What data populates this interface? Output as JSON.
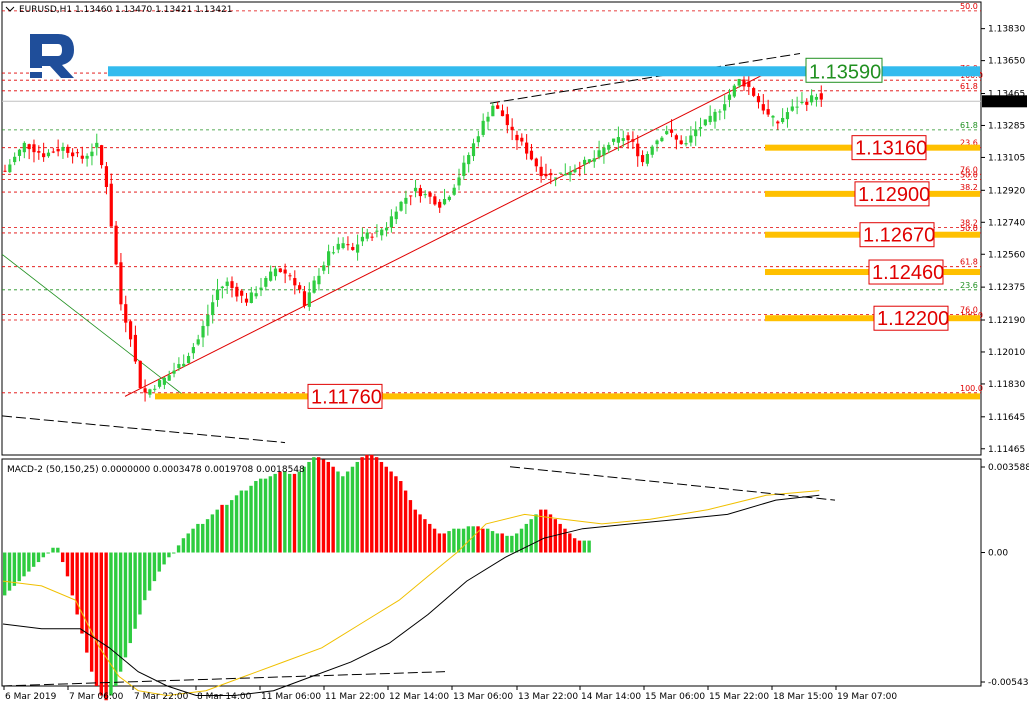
{
  "header": {
    "main_title": "EURUSD,H1  1.13460 1.13470 1.13421 1.13421",
    "macd_title": "MACD-2 (50,150,25) 0.0000000 0.0003478 0.0019708 0.0018548"
  },
  "colors": {
    "bull": "#2ecc40",
    "bear": "#ff0000",
    "fib_red": "#e00000",
    "fib_green": "#209020",
    "level_orange": "#ffc000",
    "level_blue": "#33bbee",
    "signal_line": "#f0c000",
    "macd_line": "#000000",
    "logo": "#1f4e9a"
  },
  "chart_data": [
    {
      "type": "candlestick",
      "title": "EURUSD,H1  1.13460 1.13470 1.13421 1.13421",
      "y_ticks": [
        "1.13830",
        "1.13650",
        "1.13465",
        "1.13285",
        "1.13105",
        "1.12920",
        "1.12740",
        "1.12560",
        "1.12375",
        "1.12190",
        "1.12010",
        "1.11830",
        "1.11645",
        "1.11465"
      ],
      "current_price": "1.13421",
      "x_ticks": [
        "6 Mar 2019",
        "7 Mar 06:00",
        "7 Mar 22:00",
        "8 Mar 14:00",
        "11 Mar 06:00",
        "11 Mar 22:00",
        "12 Mar 14:00",
        "13 Mar 06:00",
        "13 Mar 22:00",
        "14 Mar 14:00",
        "15 Mar 06:00",
        "15 Mar 22:00",
        "18 Mar 15:00",
        "19 Mar 07:00"
      ],
      "price_path": [
        [
          0,
          1.1303
        ],
        [
          4,
          1.1318
        ],
        [
          8,
          1.1312
        ],
        [
          12,
          1.1316
        ],
        [
          16,
          1.131
        ],
        [
          19,
          1.1317
        ],
        [
          21,
          1.1295
        ],
        [
          23,
          1.125
        ],
        [
          24,
          1.1228
        ],
        [
          26,
          1.121
        ],
        [
          27,
          1.1195
        ],
        [
          28,
          1.1182
        ],
        [
          29,
          1.1178
        ],
        [
          31,
          1.1182
        ],
        [
          34,
          1.1188
        ],
        [
          37,
          1.1196
        ],
        [
          40,
          1.1208
        ],
        [
          42,
          1.1222
        ],
        [
          44,
          1.1236
        ],
        [
          46,
          1.124
        ],
        [
          48,
          1.1234
        ],
        [
          50,
          1.123
        ],
        [
          53,
          1.1238
        ],
        [
          56,
          1.1248
        ],
        [
          59,
          1.1244
        ],
        [
          61,
          1.1236
        ],
        [
          62,
          1.1226
        ],
        [
          64,
          1.124
        ],
        [
          67,
          1.1256
        ],
        [
          70,
          1.1262
        ],
        [
          72,
          1.1258
        ],
        [
          74,
          1.1266
        ],
        [
          77,
          1.1268
        ],
        [
          79,
          1.1272
        ],
        [
          81,
          1.1282
        ],
        [
          83,
          1.1288
        ],
        [
          85,
          1.1292
        ],
        [
          88,
          1.1288
        ],
        [
          90,
          1.1284
        ],
        [
          92,
          1.129
        ],
        [
          94,
          1.13
        ],
        [
          96,
          1.1312
        ],
        [
          99,
          1.133
        ],
        [
          101,
          1.134
        ],
        [
          103,
          1.1334
        ],
        [
          105,
          1.1324
        ],
        [
          107,
          1.1318
        ],
        [
          109,
          1.131
        ],
        [
          111,
          1.1302
        ],
        [
          113,
          1.13
        ],
        [
          116,
          1.1302
        ],
        [
          119,
          1.1306
        ],
        [
          122,
          1.131
        ],
        [
          125,
          1.1318
        ],
        [
          128,
          1.1322
        ],
        [
          130,
          1.1318
        ],
        [
          132,
          1.1308
        ],
        [
          134,
          1.1318
        ],
        [
          137,
          1.1326
        ],
        [
          139,
          1.132
        ],
        [
          141,
          1.1318
        ],
        [
          143,
          1.1326
        ],
        [
          146,
          1.1332
        ],
        [
          148,
          1.1338
        ],
        [
          150,
          1.1346
        ],
        [
          152,
          1.1354
        ],
        [
          154,
          1.135
        ],
        [
          156,
          1.1342
        ],
        [
          158,
          1.1334
        ],
        [
          160,
          1.133
        ],
        [
          162,
          1.1336
        ],
        [
          164,
          1.134
        ],
        [
          166,
          1.1342
        ],
        [
          168,
          1.1346
        ],
        [
          169,
          1.1342
        ]
      ],
      "fib_levels": [
        {
          "price": 1.1359,
          "label": "1.13590",
          "pct": "76.0",
          "color": "green"
        },
        {
          "price": 1.1316,
          "label": "1.13160",
          "pct": "23.6",
          "color": "red"
        },
        {
          "price": 1.129,
          "label": "1.12900",
          "pct": "38.2",
          "color": "red"
        },
        {
          "price": 1.1267,
          "label": "1.12670",
          "pct": "38.2",
          "color": "red"
        },
        {
          "price": 1.1246,
          "label": "1.12460",
          "pct": "61.8",
          "color": "red"
        },
        {
          "price": 1.122,
          "label": "1.12200",
          "pct": "76.0",
          "color": "red"
        },
        {
          "price": 1.1176,
          "label": "1.11760",
          "pct": "100.0",
          "color": "red"
        }
      ],
      "fib_small_labels": [
        {
          "price": 1.1393,
          "text": "50.0",
          "color": "red"
        },
        {
          "price": 1.1358,
          "text": "76.0",
          "color": "red"
        },
        {
          "price": 1.1354,
          "text": "100.0",
          "color": "red"
        },
        {
          "price": 1.1348,
          "text": "61.8",
          "color": "red"
        },
        {
          "price": 1.1326,
          "text": "61.8",
          "color": "green"
        },
        {
          "price": 1.1316,
          "text": "23.6",
          "color": "red"
        },
        {
          "price": 1.1301,
          "text": "76.0",
          "color": "red"
        },
        {
          "price": 1.1298,
          "text": "50.0",
          "color": "red"
        },
        {
          "price": 1.1291,
          "text": "38.2",
          "color": "red"
        },
        {
          "price": 1.1271,
          "text": "38.2",
          "color": "red"
        },
        {
          "price": 1.1268,
          "text": "50.0",
          "color": "red"
        },
        {
          "price": 1.1249,
          "text": "61.8",
          "color": "red"
        },
        {
          "price": 1.1236,
          "text": "23.6",
          "color": "green"
        },
        {
          "price": 1.1222,
          "text": "76.0",
          "color": "red"
        },
        {
          "price": 1.1219,
          "text": "100.0",
          "color": "red"
        },
        {
          "price": 1.1178,
          "text": "100.0",
          "color": "red"
        }
      ]
    },
    {
      "type": "bar",
      "title": "MACD-2 (50,150,25) 0.0000000 0.0003478 0.0019708 0.0018548",
      "y_ticks": [
        "0.0035887",
        "0.00",
        "-0.0054336"
      ],
      "histogram": [
        -0.0018,
        -0.0016,
        -0.0014,
        -0.0012,
        -0.001,
        -0.0008,
        -0.0006,
        -0.0004,
        -0.0002,
        0.0,
        0.0002,
        0.0002,
        -0.0004,
        -0.001,
        -0.0018,
        -0.0026,
        -0.0034,
        -0.0042,
        -0.005,
        -0.0056,
        -0.006,
        -0.0062,
        -0.006,
        -0.0056,
        -0.005,
        -0.0044,
        -0.0038,
        -0.0032,
        -0.0026,
        -0.002,
        -0.0016,
        -0.0012,
        -0.0008,
        -0.0005,
        -0.0002,
        0.0,
        0.0003,
        0.0006,
        0.0008,
        0.001,
        0.0012,
        0.0012,
        0.0014,
        0.0016,
        0.0018,
        0.002,
        0.002,
        0.0022,
        0.0024,
        0.0026,
        0.0026,
        0.0028,
        0.003,
        0.0031,
        0.0031,
        0.0032,
        0.0033,
        0.0034,
        0.0034,
        0.0033,
        0.0033,
        0.0034,
        0.0036,
        0.0038,
        0.004,
        0.004,
        0.0039,
        0.0038,
        0.0036,
        0.0034,
        0.0032,
        0.0034,
        0.0036,
        0.0038,
        0.004,
        0.0041,
        0.0041,
        0.004,
        0.0038,
        0.0036,
        0.0034,
        0.0032,
        0.003,
        0.0026,
        0.0022,
        0.0018,
        0.0016,
        0.0014,
        0.0012,
        0.001,
        0.0008,
        0.0008,
        0.0009,
        0.001,
        0.001,
        0.001,
        0.0011,
        0.0011,
        0.0011,
        0.001,
        0.001,
        0.0009,
        0.0008,
        0.0008,
        0.0007,
        0.0007,
        0.0008,
        0.001,
        0.0012,
        0.0014,
        0.0016,
        0.0018,
        0.0018,
        0.0016,
        0.0014,
        0.0012,
        0.001,
        0.0008,
        0.0006,
        0.0005,
        0.0005,
        0.0005
      ],
      "bar_colors": [
        "g",
        "g",
        "g",
        "g",
        "g",
        "g",
        "g",
        "g",
        "g",
        "g",
        "g",
        "g",
        "r",
        "r",
        "r",
        "r",
        "r",
        "r",
        "r",
        "r",
        "r",
        "r",
        "g",
        "g",
        "g",
        "g",
        "g",
        "g",
        "g",
        "g",
        "g",
        "g",
        "g",
        "g",
        "g",
        "g",
        "g",
        "g",
        "g",
        "g",
        "g",
        "g",
        "g",
        "g",
        "g",
        "r",
        "g",
        "g",
        "g",
        "g",
        "g",
        "g",
        "g",
        "g",
        "g",
        "g",
        "g",
        "r",
        "g",
        "g",
        "r",
        "g",
        "g",
        "g",
        "g",
        "r",
        "r",
        "r",
        "r",
        "g",
        "g",
        "g",
        "g",
        "g",
        "r",
        "r",
        "r",
        "r",
        "r",
        "r",
        "r",
        "r",
        "r",
        "r",
        "r",
        "r",
        "r",
        "r",
        "r",
        "r",
        "r",
        "r",
        "g",
        "g",
        "g",
        "g",
        "g",
        "g",
        "r",
        "r",
        "g",
        "g",
        "g",
        "r",
        "g",
        "g",
        "g",
        "g",
        "g",
        "g",
        "g",
        "r",
        "r",
        "r",
        "r",
        "r",
        "r",
        "r",
        "r",
        "r",
        "g",
        "g"
      ],
      "signal_path": [
        [
          0,
          -0.0012
        ],
        [
          8,
          -0.0014
        ],
        [
          15,
          -0.002
        ],
        [
          20,
          -0.004
        ],
        [
          24,
          -0.0052
        ],
        [
          28,
          -0.0058
        ],
        [
          34,
          -0.006
        ],
        [
          42,
          -0.0058
        ],
        [
          50,
          -0.0052
        ],
        [
          58,
          -0.0046
        ],
        [
          66,
          -0.004
        ],
        [
          74,
          -0.003
        ],
        [
          82,
          -0.002
        ],
        [
          88,
          -0.001
        ],
        [
          94,
          0.0
        ],
        [
          100,
          0.0012
        ],
        [
          108,
          0.0016
        ],
        [
          116,
          0.0014
        ],
        [
          124,
          0.0012
        ],
        [
          134,
          0.0014
        ],
        [
          146,
          0.0018
        ],
        [
          158,
          0.0024
        ],
        [
          169,
          0.0026
        ]
      ],
      "macd_path": [
        [
          0,
          -0.003
        ],
        [
          8,
          -0.0032
        ],
        [
          16,
          -0.0032
        ],
        [
          22,
          -0.004
        ],
        [
          28,
          -0.005
        ],
        [
          34,
          -0.0056
        ],
        [
          40,
          -0.006
        ],
        [
          48,
          -0.006
        ],
        [
          56,
          -0.0058
        ],
        [
          64,
          -0.0052
        ],
        [
          72,
          -0.0046
        ],
        [
          80,
          -0.0038
        ],
        [
          88,
          -0.0026
        ],
        [
          96,
          -0.0012
        ],
        [
          104,
          -0.0002
        ],
        [
          112,
          0.0006
        ],
        [
          120,
          0.001
        ],
        [
          130,
          0.0012
        ],
        [
          140,
          0.0014
        ],
        [
          150,
          0.0016
        ],
        [
          160,
          0.0022
        ],
        [
          169,
          0.0024
        ]
      ],
      "zero_line": 0
    }
  ]
}
